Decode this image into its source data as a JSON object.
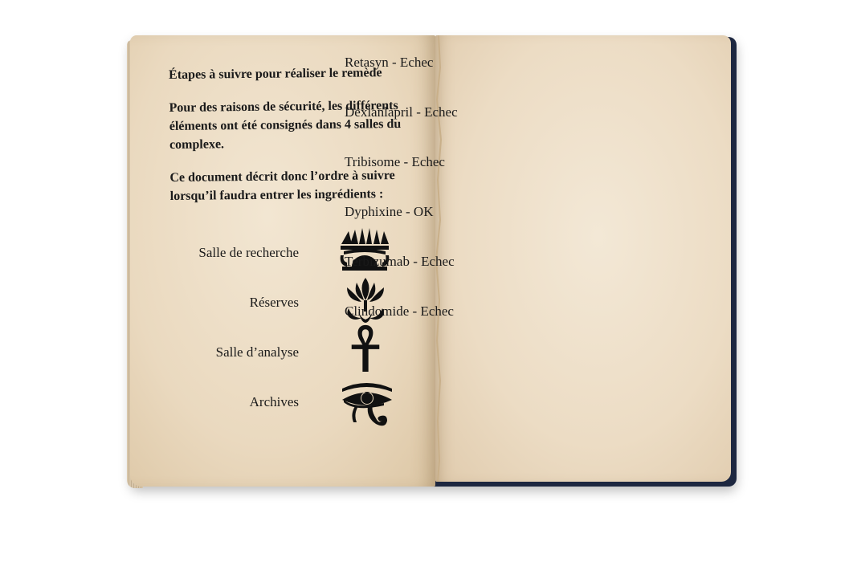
{
  "left_page": {
    "title": "Étapes à suivre pour réaliser le remède",
    "paragraph1": "Pour des raisons de sécurité, les différents éléments ont été consignés dans 4 salles du complexe.",
    "paragraph2": "Ce document décrit donc l’ordre à suivre lorsqu’il faudra entrer les ingrédients :",
    "rooms": [
      {
        "label": "Salle de recherche",
        "icon": "sun-disk-icon"
      },
      {
        "label": "Réserves",
        "icon": "lotus-icon"
      },
      {
        "label": "Salle d’analyse",
        "icon": "ankh-icon"
      },
      {
        "label": "Archives",
        "icon": "eye-of-horus-icon"
      }
    ]
  },
  "right_page": {
    "entries": [
      "Retasyn - Echec",
      "Dexlanlapril - Echec",
      "Tribisome - Echec",
      "Dyphixine - OK",
      "Terbizumab - Echec",
      "Clindomide - Echec"
    ]
  }
}
